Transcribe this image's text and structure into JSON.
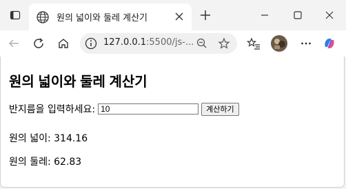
{
  "browser": {
    "tab_title": "원의 넓이와 둘레 계산기",
    "address": {
      "host": "127.0.0.1",
      "rest": ":5500/js-..."
    }
  },
  "page": {
    "heading": "원의 넓이와 둘레 계산기",
    "radius_label": "반지름을 입력하세요:",
    "radius_value": "10",
    "calc_button": "계산하기",
    "area_text": "원의 넓이: 314.16",
    "circumference_text": "원의 둘레: 62.83"
  }
}
